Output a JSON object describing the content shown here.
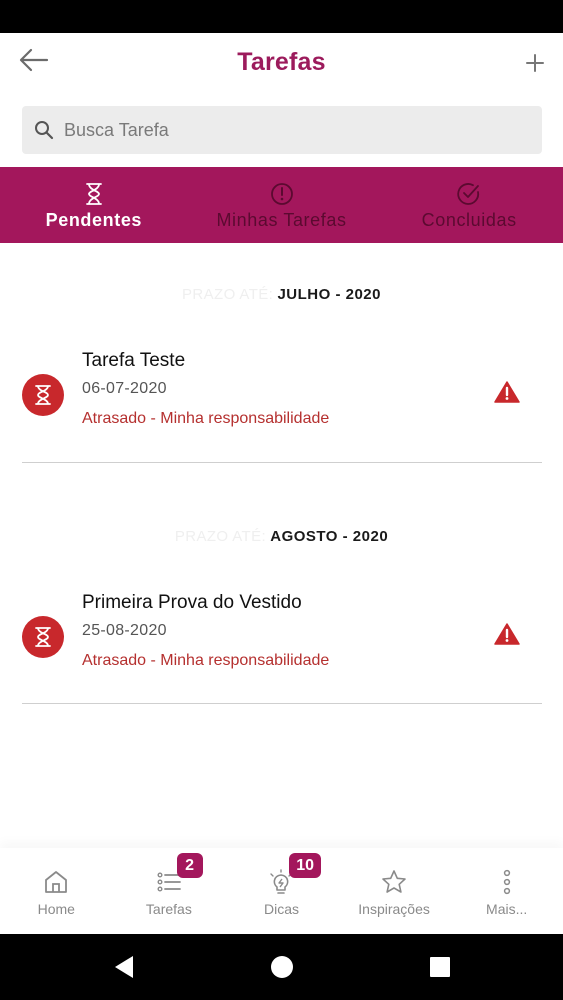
{
  "header": {
    "title": "Tarefas"
  },
  "search": {
    "placeholder": "Busca Tarefa",
    "value": ""
  },
  "tabs": [
    {
      "label": "Pendentes",
      "icon": "hourglass-icon",
      "active": true
    },
    {
      "label": "Minhas Tarefas",
      "icon": "exclamation-circle-icon",
      "active": false
    },
    {
      "label": "Concluidas",
      "icon": "check-circle-icon",
      "active": false
    }
  ],
  "sections": [
    {
      "prefix": "PRAZO ATÉ:",
      "month": "JULHO - 2020",
      "tasks": [
        {
          "name": "Tarefa Teste",
          "date": "06-07-2020",
          "status": "Atrasado - Minha responsabilidade"
        }
      ]
    },
    {
      "prefix": "PRAZO ATÉ:",
      "month": "AGOSTO - 2020",
      "tasks": [
        {
          "name": "Primeira Prova do Vestido",
          "date": "25-08-2020",
          "status": "Atrasado - Minha responsabilidade"
        }
      ]
    }
  ],
  "bottom_nav": [
    {
      "label": "Home",
      "icon": "home-icon"
    },
    {
      "label": "Tarefas",
      "icon": "task-list-icon",
      "badge": "2"
    },
    {
      "label": "Dicas",
      "icon": "lightbulb-icon",
      "badge": "10"
    },
    {
      "label": "Inspirações",
      "icon": "star-icon"
    },
    {
      "label": "Mais...",
      "icon": "more-vertical-icon"
    }
  ],
  "colors": {
    "brand": "#a3175c",
    "title": "#9c1b5c",
    "alert": "#c8282c"
  }
}
